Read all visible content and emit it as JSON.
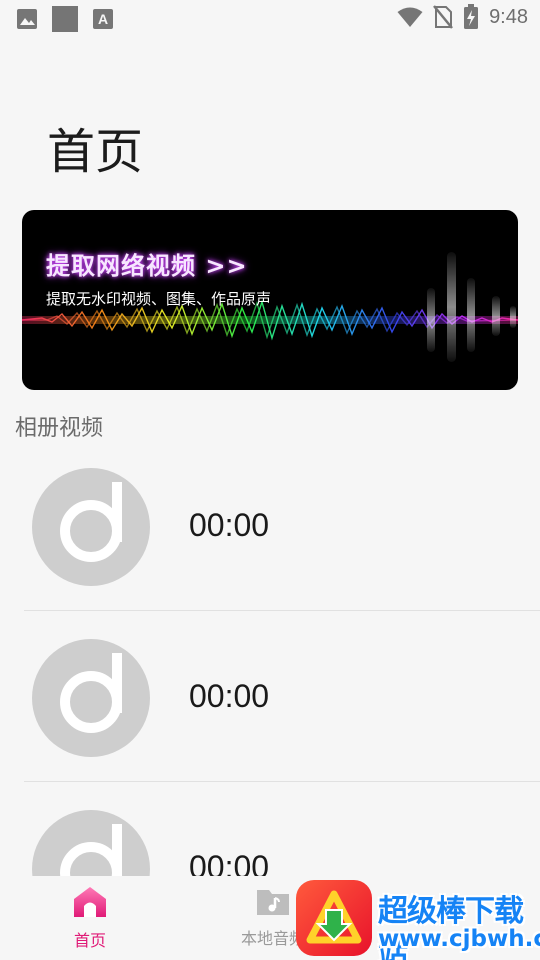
{
  "status_bar": {
    "time": "9:48",
    "left_icons": [
      "image-icon",
      "gray-square",
      "a-box-icon"
    ],
    "right_icons": [
      "wifi-icon",
      "no-sim-icon",
      "battery-charging-icon"
    ]
  },
  "page": {
    "title": "首页"
  },
  "banner": {
    "title": "提取网络视频 >>",
    "subtitle": "提取无水印视频、图集、作品原声"
  },
  "section": {
    "title": "相册视频"
  },
  "videos": [
    {
      "duration": "00:00",
      "icon": "music-disc-icon"
    },
    {
      "duration": "00:00",
      "icon": "music-disc-icon"
    },
    {
      "duration": "00:00",
      "icon": "music-disc-icon"
    }
  ],
  "bottom_nav": {
    "home_label": "首页",
    "local_audio_label": "本地音频"
  },
  "watermark": {
    "line1": "超级棒下载站",
    "line2": "www.cjbwh.com"
  },
  "colors": {
    "accent": "#e01a77",
    "inactive": "#9a9a9a",
    "watermark_blue": "#1583f5"
  }
}
